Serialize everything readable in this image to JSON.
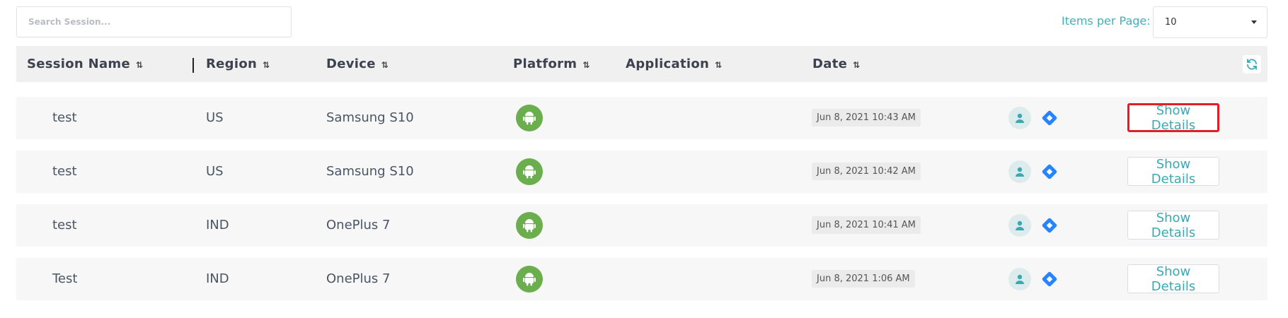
{
  "search": {
    "placeholder": "Search Session..."
  },
  "pagination": {
    "label": "Items per Page:",
    "value": "10"
  },
  "columns": {
    "session_name": "Session Name",
    "region": "Region",
    "device": "Device",
    "platform": "Platform",
    "application": "Application",
    "date": "Date",
    "sort_glyph": "⇅"
  },
  "rows": [
    {
      "session_name": "test",
      "region": "US",
      "device": "Samsung S10",
      "platform": "android-icon",
      "application": "",
      "date": "Jun 8, 2021 10:43 AM",
      "action": "Show Details"
    },
    {
      "session_name": "test",
      "region": "US",
      "device": "Samsung S10",
      "platform": "android-icon",
      "application": "",
      "date": "Jun 8, 2021 10:42 AM",
      "action": "Show Details"
    },
    {
      "session_name": "test",
      "region": "IND",
      "device": "OnePlus 7",
      "platform": "android-icon",
      "application": "",
      "date": "Jun 8, 2021 10:41 AM",
      "action": "Show Details"
    },
    {
      "session_name": "Test",
      "region": "IND",
      "device": "OnePlus 7",
      "platform": "android-icon",
      "application": "",
      "date": "Jun 8, 2021 1:06 AM",
      "action": "Show Details"
    }
  ],
  "colors": {
    "accent": "#3aa9b3",
    "android": "#6aae4e",
    "jira": "#2684ff",
    "highlight": "#e01e26"
  }
}
